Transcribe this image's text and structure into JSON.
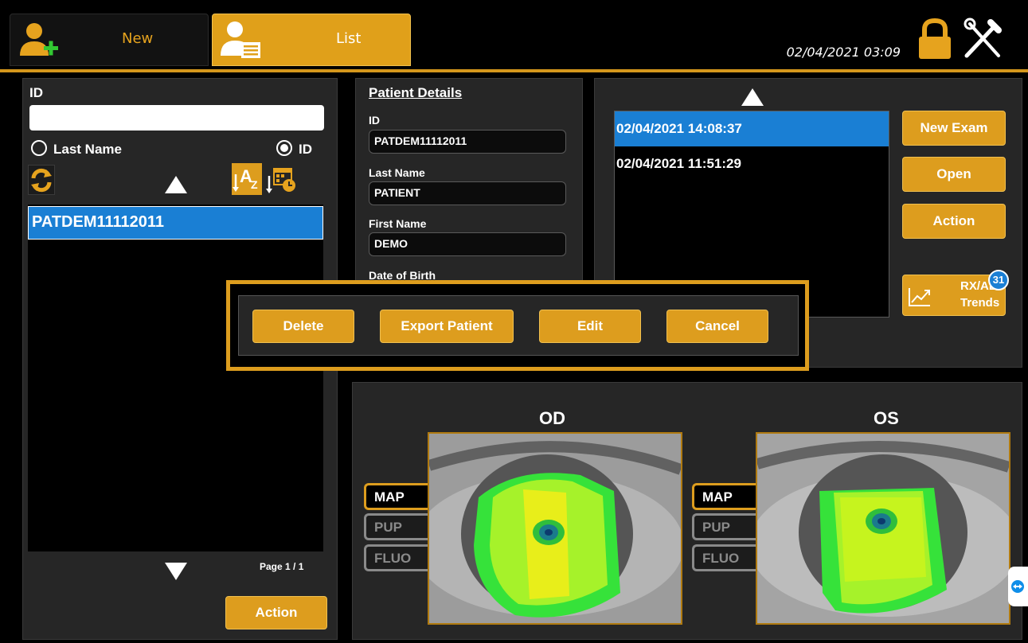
{
  "tabs": {
    "new_label": "New",
    "list_label": "List"
  },
  "header": {
    "datetime": "02/04/2021 03:09"
  },
  "search": {
    "id_label": "ID",
    "id_value": "",
    "radio_lastname_label": "Last Name",
    "radio_id_label": "ID",
    "selected_radio": "ID"
  },
  "patient_list": {
    "items": [
      "PATDEM11112011"
    ],
    "selected_index": 0,
    "page_text": "Page  1  /  1",
    "action_label": "Action"
  },
  "details": {
    "title": "Patient Details",
    "id_label": "ID",
    "id_value": "PATDEM11112011",
    "last_name_label": "Last Name",
    "last_name_value": "PATIENT",
    "first_name_label": "First Name",
    "first_name_value": "DEMO",
    "dob_label": "Date of Birth"
  },
  "exams": {
    "items": [
      "02/04/2021 14:08:37",
      "02/04/2021 11:51:29"
    ],
    "selected_index": 0,
    "new_exam_label": "New Exam",
    "open_label": "Open",
    "action_label": "Action",
    "trends_line1": "RX/AL",
    "trends_line2": "Trends",
    "trends_badge": "31"
  },
  "popup": {
    "delete_label": "Delete",
    "export_label": "Export Patient",
    "edit_label": "Edit",
    "cancel_label": "Cancel"
  },
  "eyes": {
    "od_title": "OD",
    "os_title": "OS",
    "map_label": "MAP",
    "pup_label": "PUP",
    "fluo_label": "FLUO"
  },
  "colors": {
    "accent": "#dd9d1e",
    "selection": "#1a7fd4",
    "panel": "#262626",
    "badge": "#1a7fd4"
  },
  "icons": [
    "add-user-icon",
    "patient-list-icon",
    "lock-icon",
    "tools-icon",
    "refresh-icon",
    "sort-az-icon",
    "sort-date-icon",
    "trends-chart-icon",
    "teamviewer-icon"
  ]
}
